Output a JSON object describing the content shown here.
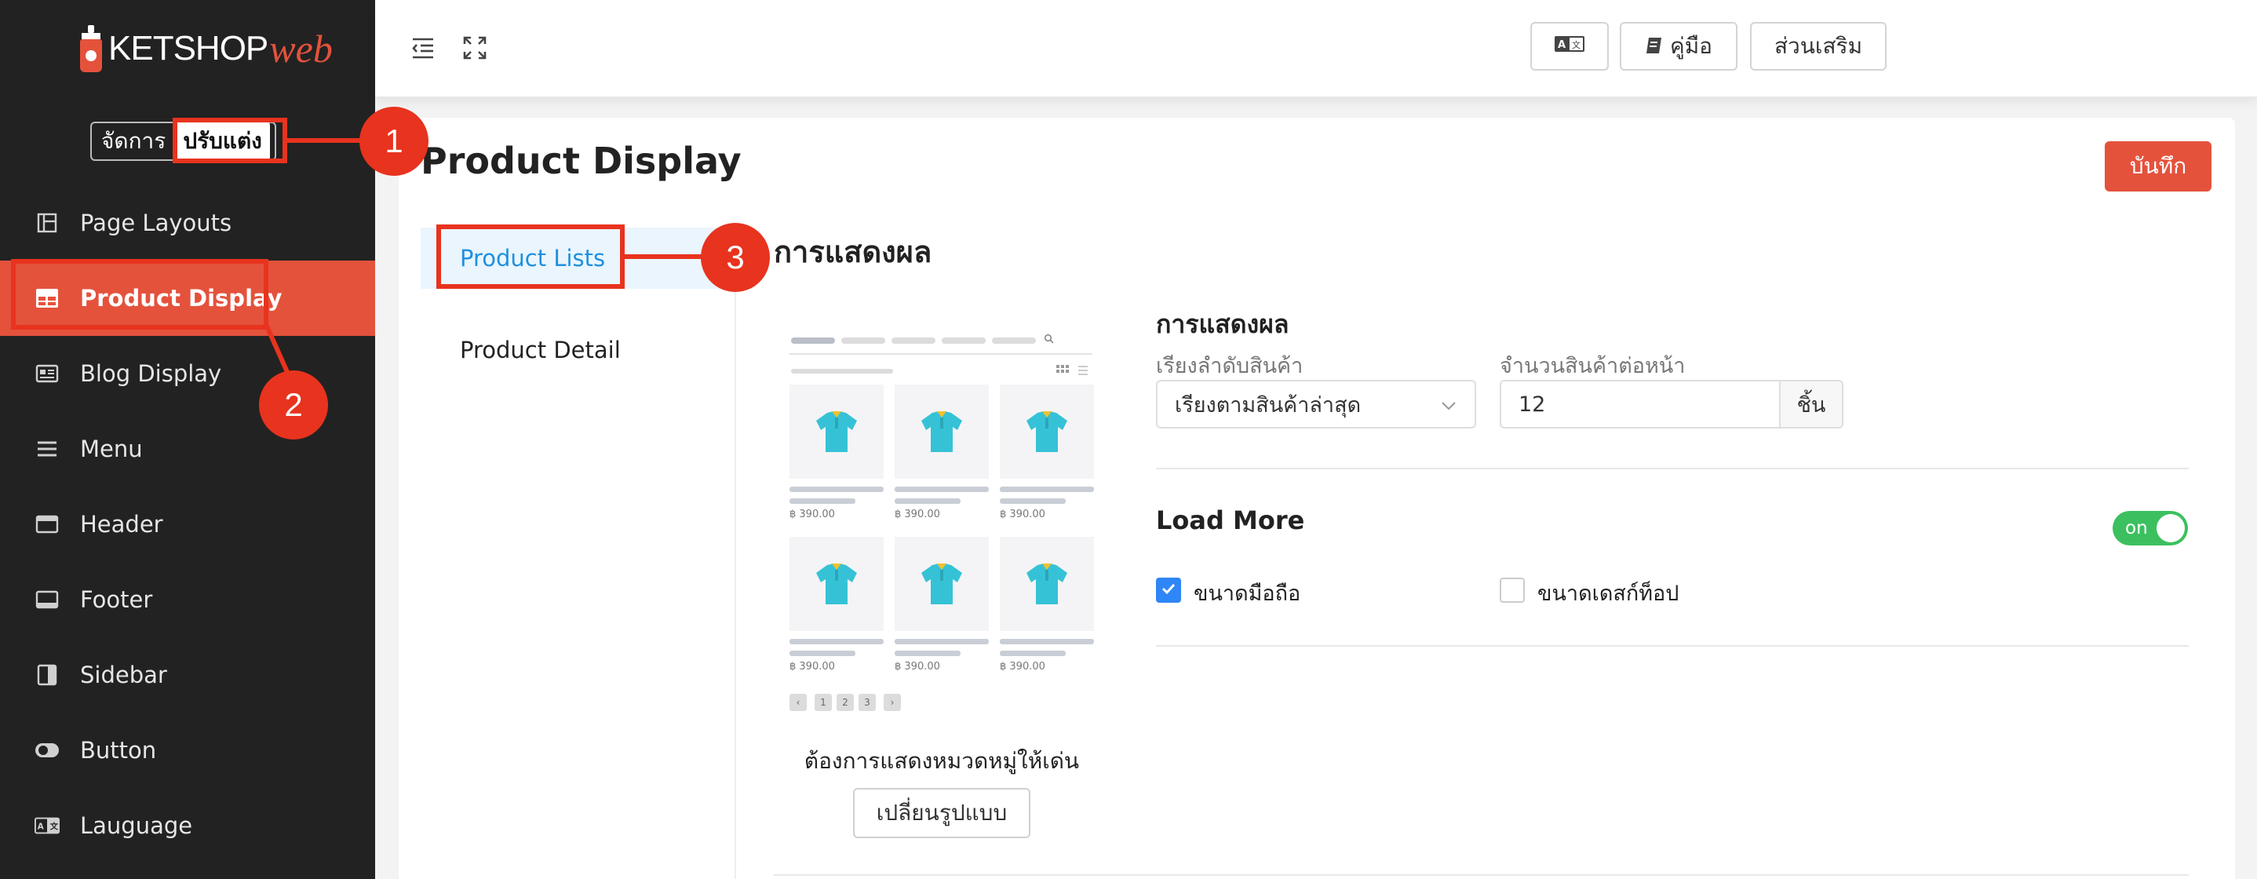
{
  "logo": {
    "name": "KETSHOP",
    "suffix": "web"
  },
  "mode": {
    "manage": "จัดการ",
    "customize": "ปรับแต่ง"
  },
  "sidebar": {
    "items": [
      {
        "label": "Page Layouts",
        "icon": "layout-icon"
      },
      {
        "label": "Product Display",
        "icon": "grid-icon"
      },
      {
        "label": "Blog Display",
        "icon": "blog-icon"
      },
      {
        "label": "Menu",
        "icon": "menu-icon"
      },
      {
        "label": "Header",
        "icon": "header-icon"
      },
      {
        "label": "Footer",
        "icon": "footer-icon"
      },
      {
        "label": "Sidebar",
        "icon": "sidebar-icon"
      },
      {
        "label": "Button",
        "icon": "toggle-icon"
      },
      {
        "label": "Lauguage",
        "icon": "language-icon"
      }
    ]
  },
  "topbar": {
    "manual": "คู่มือ",
    "addons": "ส่วนเสริม"
  },
  "page": {
    "title": "Product Display",
    "save": "บันทึก"
  },
  "subnav": {
    "lists": "Product Lists",
    "detail": "Product Detail"
  },
  "section": {
    "title": "การแสดงผล"
  },
  "preview": {
    "price": "฿ 390.00",
    "pages": [
      "1",
      "2",
      "3"
    ],
    "highlight_text": "ต้องการแสดงหมวดหมู่ให้เด่น",
    "change_button": "เปลี่ยนรูปแบบ"
  },
  "settings": {
    "title": "การแสดงผล",
    "sort_label": "เรียงลำดับสินค้า",
    "sort_value": "เรียงตามสินค้าล่าสุด",
    "per_page_label": "จำนวนสินค้าต่อหน้า",
    "per_page_value": "12",
    "unit": "ชิ้น",
    "load_more_title": "Load More",
    "toggle_label": "on",
    "mobile_label": "ขนาดมือถือ",
    "desktop_label": "ขนาดเดสก์ท็อป"
  },
  "annotations": [
    "1",
    "2",
    "3"
  ],
  "colors": {
    "accent": "#e4523c",
    "sidebar_bg": "#222222",
    "annotation": "#e8331e",
    "link": "#1e90e0",
    "toggle_on": "#3cc05f",
    "checkbox": "#2f86f6"
  }
}
